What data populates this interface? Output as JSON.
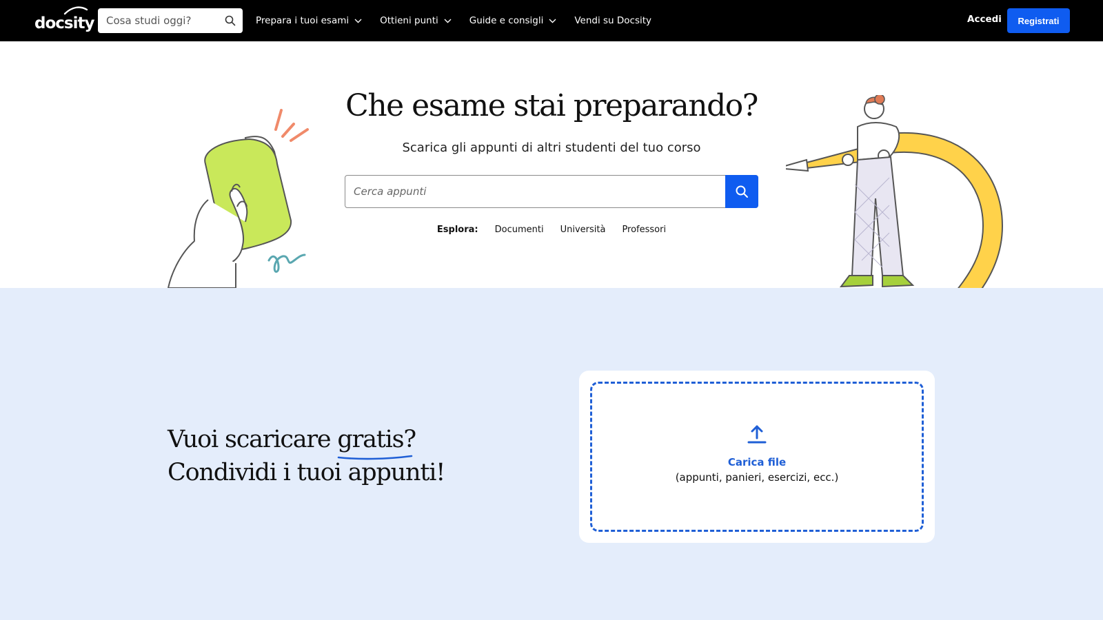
{
  "header": {
    "logo_text": "docsity",
    "search_placeholder": "Cosa studi oggi?",
    "nav": [
      {
        "label": "Prepara i tuoi esami",
        "has_dropdown": true
      },
      {
        "label": "Ottieni punti",
        "has_dropdown": true
      },
      {
        "label": "Guide e consigli",
        "has_dropdown": true
      },
      {
        "label": "Vendi su Docsity",
        "has_dropdown": false
      }
    ],
    "login_label": "Accedi",
    "signup_label": "Registrati"
  },
  "hero": {
    "title": "Che esame stai preparando?",
    "subtitle": "Scarica gli appunti di altri studenti del tuo corso",
    "search_placeholder": "Cerca appunti",
    "explore_label": "Esplora:",
    "explore_links": [
      "Documenti",
      "Università",
      "Professori"
    ]
  },
  "share": {
    "line1_before": "Vuoi scaricare ",
    "line1_highlight": "gratis?",
    "line2": "Condividi i tuoi appunti!",
    "upload_title": "Carica file",
    "upload_subtitle": "(appunti, panieri, esercizi, ecc.)"
  },
  "colors": {
    "brand_blue": "#0f5cf0",
    "band_background": "#e4edfb",
    "topbar": "#000000"
  }
}
